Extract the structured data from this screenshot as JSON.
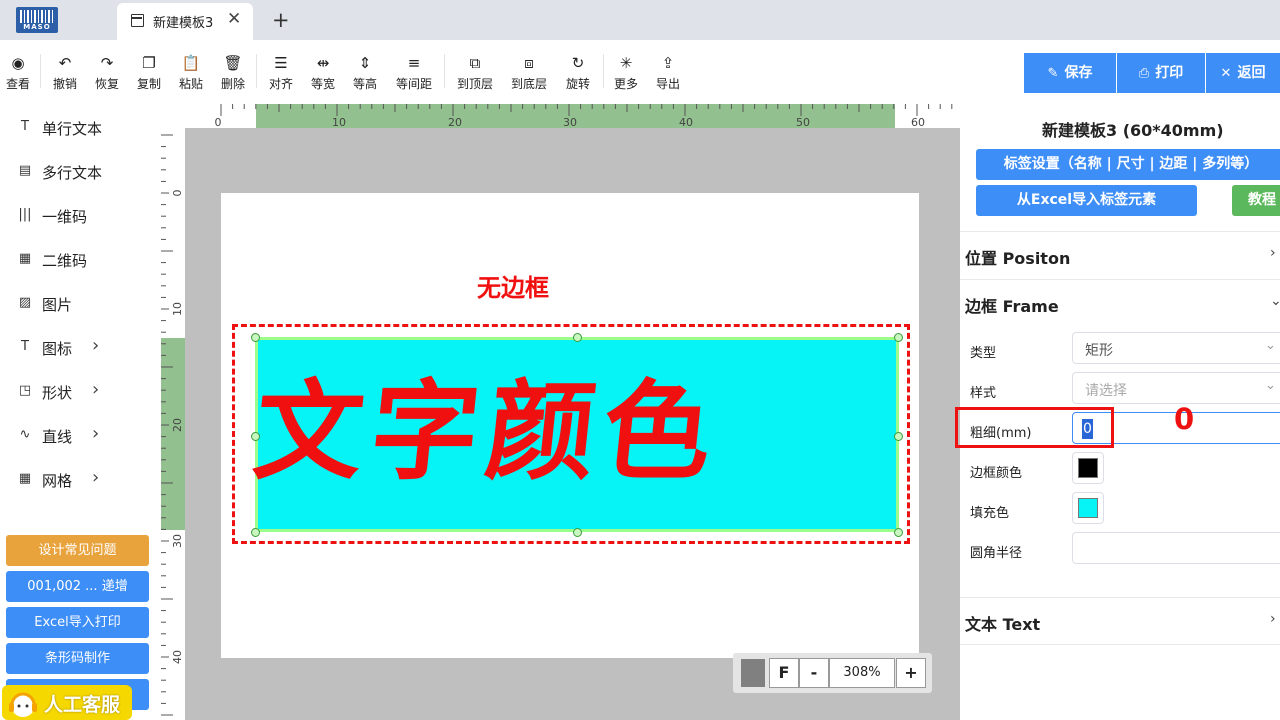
{
  "app": {
    "logo_text": "MASO",
    "tab_label": "新建模板3",
    "tab_close": "✕",
    "tab_add": "+"
  },
  "toolbar": {
    "tools": [
      {
        "label": "查看",
        "icon": "◉"
      },
      {
        "label": "撤销",
        "icon": "↶"
      },
      {
        "label": "恢复",
        "icon": "↷"
      },
      {
        "label": "复制",
        "icon": "❐"
      },
      {
        "label": "粘贴",
        "icon": "📋"
      },
      {
        "label": "删除",
        "icon": "🗑"
      },
      {
        "label": "对齐",
        "icon": "☰"
      },
      {
        "label": "等宽",
        "icon": "⇹"
      },
      {
        "label": "等高",
        "icon": "⇕"
      },
      {
        "label": "等间距",
        "icon": "≡"
      },
      {
        "label": "到顶层",
        "icon": "⧉"
      },
      {
        "label": "到底层",
        "icon": "⧈"
      },
      {
        "label": "旋转",
        "icon": "↻"
      },
      {
        "label": "更多",
        "icon": "✳"
      },
      {
        "label": "导出",
        "icon": "⇪"
      }
    ],
    "save": "保存",
    "print": "打印",
    "back": "返回",
    "save_icon": "✎",
    "print_icon": "⎙",
    "back_icon": "✕"
  },
  "components": [
    {
      "label": "单行文本",
      "icon": "T",
      "chevron": ""
    },
    {
      "label": "多行文本",
      "icon": "▤",
      "chevron": ""
    },
    {
      "label": "一维码",
      "icon": "|||",
      "chevron": ""
    },
    {
      "label": "二维码",
      "icon": "▦",
      "chevron": ""
    },
    {
      "label": "图片",
      "icon": "▨",
      "chevron": ""
    },
    {
      "label": "图标",
      "icon": "T",
      "chevron": "›"
    },
    {
      "label": "形状",
      "icon": "◳",
      "chevron": "›"
    },
    {
      "label": "直线",
      "icon": "∿",
      "chevron": "›"
    },
    {
      "label": "网格",
      "icon": "▦",
      "chevron": "›"
    }
  ],
  "help_buttons": [
    {
      "label": "设计常见问题",
      "color": "#e8a33d"
    },
    {
      "label": "001,002 ... 递增",
      "color": "#3e8ef7"
    },
    {
      "label": "Excel导入打印",
      "color": "#3e8ef7"
    },
    {
      "label": "条形码制作",
      "color": "#3e8ef7"
    },
    {
      "label": "",
      "color": "#3e8ef7"
    }
  ],
  "service_label": "人工客服",
  "ruler": {
    "h_labels": [
      "0",
      "10",
      "20",
      "30",
      "40",
      "50",
      "60"
    ],
    "v_labels": [
      "0",
      "10",
      "20",
      "30",
      "40"
    ]
  },
  "canvas": {
    "frame_label": "无边框",
    "main_text": "文字颜色",
    "fill_color": "#06f4f6",
    "text_color": "#f01010"
  },
  "zoom": {
    "fit": "F",
    "minus": "-",
    "value": "308%",
    "plus": "+"
  },
  "panel": {
    "title": "新建模板3 (60*40mm)",
    "label_settings": "标签设置（名称 | 尺寸 | 边距 | 多列等）",
    "import_excel": "从Excel导入标签元素",
    "tutorial": "教程",
    "sections": {
      "position": "位置 Positon",
      "frame": "边框 Frame",
      "text": "文本 Text"
    },
    "props": {
      "type_label": "类型",
      "type_value": "矩形",
      "style_label": "样式",
      "style_placeholder": "请选择",
      "thickness_label": "粗细(mm)",
      "thickness_value": "0",
      "border_color_label": "边框颜色",
      "border_color": "#000000",
      "fill_label": "填充色",
      "fill_color": "#06f4f6",
      "radius_label": "圆角半径",
      "radius_value": ""
    }
  },
  "annotation": {
    "number": "0"
  }
}
